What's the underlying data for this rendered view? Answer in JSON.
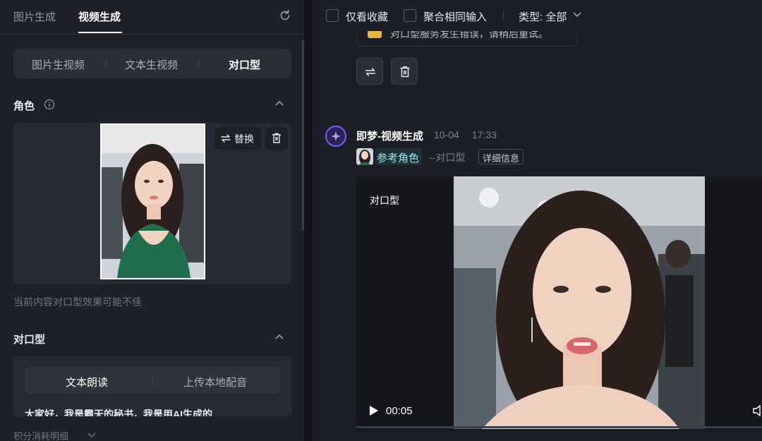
{
  "left_panel": {
    "tabs": [
      {
        "label": "图片生成",
        "active": false
      },
      {
        "label": "视频生成",
        "active": true
      }
    ],
    "mode_tabs": [
      {
        "label": "图片生视频",
        "active": false
      },
      {
        "label": "文本生视频",
        "active": false
      },
      {
        "label": "对口型",
        "active": true
      }
    ],
    "role_section": {
      "title": "角色",
      "replace_label": "替换",
      "warning": "当前内容对口型效果可能不佳"
    },
    "lip_section": {
      "title": "对口型",
      "tabs": [
        {
          "label": "文本朗读",
          "active": true
        },
        {
          "label": "上传本地配音",
          "active": false
        }
      ],
      "text": "大家好，我是霸天的秘书，我是用AI生成的"
    },
    "footer": {
      "label": "积分消耗明细"
    }
  },
  "right_panel": {
    "filters": {
      "favorites_label": "仅看收藏",
      "merge_label": "聚合相同输入",
      "type_label": "类型: 全部"
    },
    "prev_message_text": "对口型服务发生错误，请稍后重试。",
    "message": {
      "title": "即梦-视频生成",
      "date": "10-04",
      "time": "17:33",
      "ref_role_label": "参考角色",
      "ref_mode": "--对口型",
      "detail_label": "详细信息",
      "video": {
        "label": "对口型",
        "time": "00:05",
        "progress": 0
      }
    }
  },
  "colors": {
    "accent_purple": "#7e5bff",
    "ref_chip_text": "#9ee6e6",
    "warning_badge": "#e7b43c"
  }
}
